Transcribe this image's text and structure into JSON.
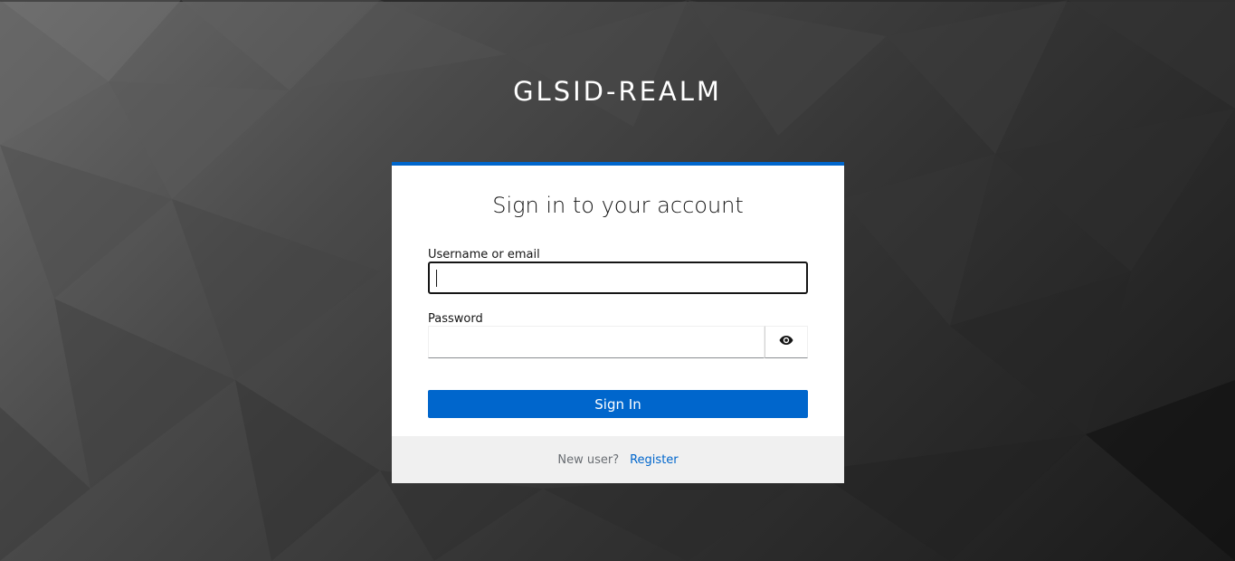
{
  "realm": {
    "title": "GLSID-REALM"
  },
  "login_card": {
    "heading": "Sign in to your account",
    "username": {
      "label": "Username or email",
      "value": "",
      "placeholder": ""
    },
    "password": {
      "label": "Password",
      "value": "",
      "placeholder": "",
      "toggle_icon": "eye-icon"
    },
    "submit_label": "Sign In",
    "footer": {
      "prompt": "New user?",
      "register_label": "Register"
    }
  },
  "colors": {
    "accent": "#0066cc",
    "card_top_border": "#0066cc",
    "footer_background": "#f0f0f0",
    "background_light": "#6a6a6a",
    "background_dark": "#1a1a1a"
  }
}
